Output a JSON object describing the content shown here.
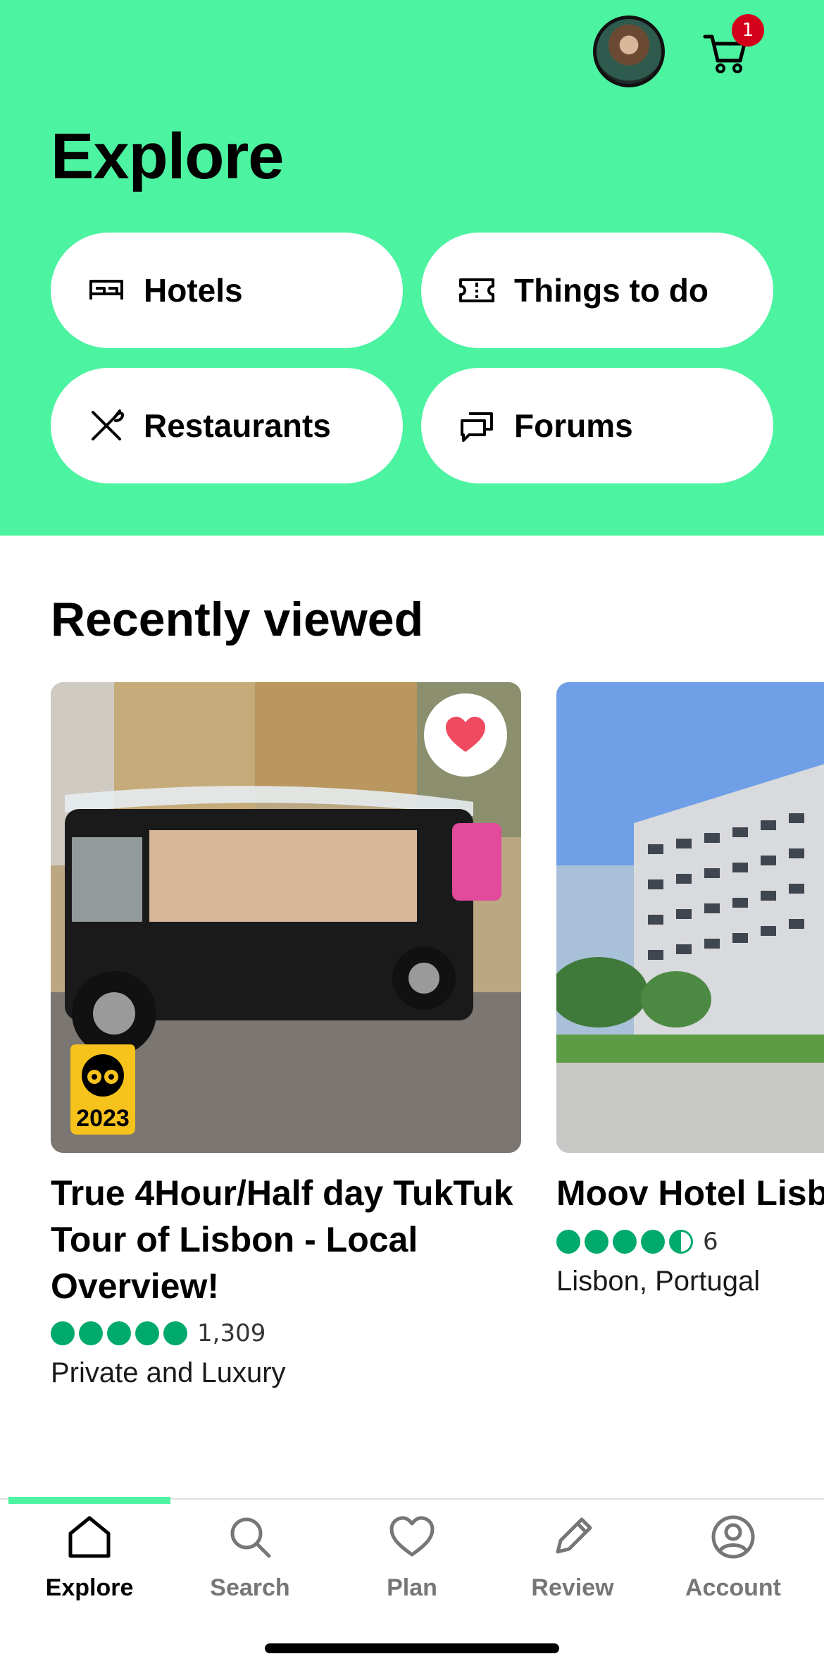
{
  "header": {
    "title": "Explore",
    "cart_badge": "1",
    "accent_color": "#4cf3a1"
  },
  "categories": [
    {
      "label": "Hotels",
      "icon": "bed-icon"
    },
    {
      "label": "Things to do",
      "icon": "ticket-icon"
    },
    {
      "label": "Restaurants",
      "icon": "utensils-icon"
    },
    {
      "label": "Forums",
      "icon": "chat-bubbles-icon"
    }
  ],
  "recently_viewed": {
    "title": "Recently viewed",
    "items": [
      {
        "title": "True 4Hour/Half day TukTuk Tour of Lisbon - Local Overview!",
        "rating": 5,
        "review_count": "1,309",
        "subtitle": "Private and Luxury",
        "award_year": "2023",
        "favorited": true
      },
      {
        "title": "Moov Hotel Lisb",
        "rating": 4.5,
        "review_count": "6",
        "subtitle": "Lisbon, Portugal"
      }
    ]
  },
  "tabs": [
    {
      "label": "Explore",
      "icon": "home-icon",
      "active": true
    },
    {
      "label": "Search",
      "icon": "search-icon",
      "active": false
    },
    {
      "label": "Plan",
      "icon": "heart-icon",
      "active": false
    },
    {
      "label": "Review",
      "icon": "pencil-icon",
      "active": false
    },
    {
      "label": "Account",
      "icon": "account-icon",
      "active": false
    }
  ]
}
